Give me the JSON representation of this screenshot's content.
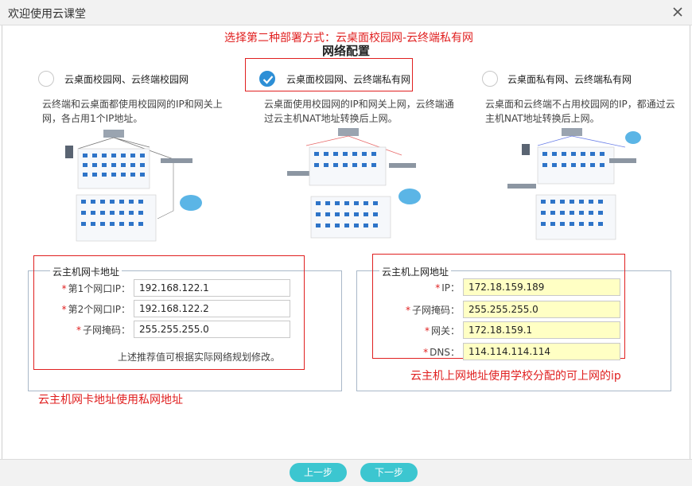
{
  "window": {
    "title": "欢迎使用云课堂"
  },
  "page": {
    "heading": "网络配置"
  },
  "annotations": {
    "top": "选择第二种部署方式：云桌面校园网-云终端私有网",
    "left": "云主机网卡地址使用私网地址",
    "right": "云主机上网地址使用学校分配的可上网的ip"
  },
  "options": [
    {
      "label": "云桌面校园网、云终端校园网",
      "desc": "云终端和云桌面都使用校园网的IP和网关上网，各占用1个IP地址。",
      "checked": false
    },
    {
      "label": "云桌面校园网、云终端私有网",
      "desc": "云桌面使用校园网的IP和网关上网，云终端通过云主机NAT地址转换后上网。",
      "checked": true
    },
    {
      "label": "云桌面私有网、云终端私有网",
      "desc": "云桌面和云终端不占用校园网的IP，都通过云主机NAT地址转换后上网。",
      "checked": false
    }
  ],
  "nic_section": {
    "legend": "云主机网卡地址",
    "fields": [
      {
        "label": "第1个网口IP",
        "value": "192.168.122.1"
      },
      {
        "label": "第2个网口IP",
        "value": "192.168.122.2"
      },
      {
        "label": "子网掩码",
        "value": "255.255.255.0"
      }
    ],
    "hint": "上述推荐值可根据实际网络规划修改。"
  },
  "inet_section": {
    "legend": "云主机上网地址",
    "fields": [
      {
        "label": "IP",
        "value": "172.18.159.189"
      },
      {
        "label": "子网掩码",
        "value": "255.255.255.0"
      },
      {
        "label": "网关",
        "value": "172.18.159.1"
      },
      {
        "label": "DNS",
        "value": "114.114.114.114"
      }
    ]
  },
  "footer": {
    "prev": "上一步",
    "next": "下一步"
  },
  "colors": {
    "accent": "#3cc6d0",
    "checked": "#2d8fd6",
    "annotation": "#e02020",
    "input_highlight": "#ffffc4"
  }
}
